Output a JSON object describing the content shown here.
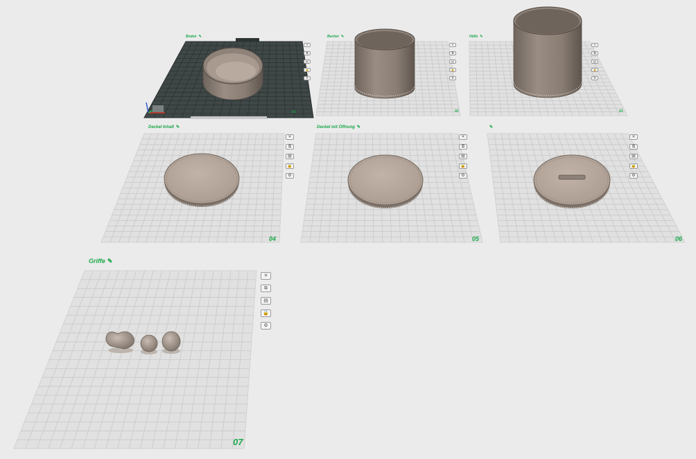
{
  "colors": {
    "background": "#ebebeb",
    "plate_fill": "#e1e1e1",
    "plate_grid": "#c8c8c8",
    "active_plate_fill": "#3f4747",
    "active_plate_grid": "#2c3333",
    "label_green": "#1aa84a",
    "model_body": "#8b7f75",
    "model_top": "#b9aaa0"
  },
  "plates": [
    {
      "label": "Boden",
      "number": "01",
      "active": true,
      "tools": [
        "close-icon",
        "arrange-icon",
        "orient-icon",
        "lock-icon",
        "settings-icon"
      ]
    },
    {
      "label": "Becher",
      "number": "02",
      "active": false,
      "tools": [
        "close-icon",
        "arrange-icon",
        "orient-icon",
        "lock-icon",
        "settings-icon"
      ]
    },
    {
      "label": "Hülle",
      "number": "03",
      "active": false,
      "tools": [
        "close-icon",
        "arrange-icon",
        "orient-icon",
        "lock-icon",
        "settings-icon"
      ]
    },
    {
      "label": "Deckel Inhalt",
      "number": "04",
      "active": false,
      "tools": [
        "close-icon",
        "arrange-icon",
        "orient-icon",
        "lock-icon",
        "settings-icon"
      ]
    },
    {
      "label": "Deckel mit Öffnung",
      "number": "05",
      "active": false,
      "tools": [
        "close-icon",
        "arrange-icon",
        "orient-icon",
        "lock-icon",
        "settings-icon"
      ]
    },
    {
      "label": "",
      "number": "06",
      "active": false,
      "tools": [
        "close-icon",
        "arrange-icon",
        "orient-icon",
        "lock-icon",
        "settings-icon"
      ]
    },
    {
      "label": "Griffe",
      "number": "07",
      "active": false,
      "tools": [
        "close-icon",
        "arrange-icon",
        "orient-icon",
        "lock-icon",
        "settings-icon"
      ]
    }
  ],
  "icon_glyphs": {
    "close-icon": "✕",
    "arrange-icon": "⧉",
    "orient-icon": "▤",
    "lock-icon": "🔒",
    "settings-icon": "⚙",
    "edit-icon": "✎"
  }
}
